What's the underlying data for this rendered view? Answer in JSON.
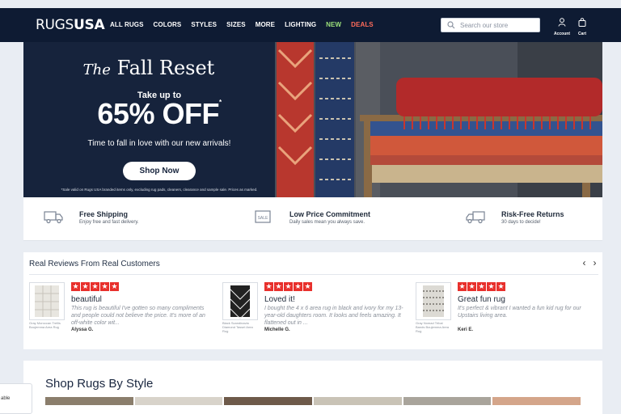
{
  "header": {
    "logo_part1": "RUGS",
    "logo_part2": "USA",
    "nav": [
      "ALL RUGS",
      "COLORS",
      "STYLES",
      "SIZES",
      "MORE",
      "LIGHTING",
      "NEW",
      "DEALS"
    ],
    "search_placeholder": "Search our store",
    "account_label": "Account",
    "cart_label": "Cart",
    "accent_new": "#9be07a",
    "accent_deals": "#ff6b5a"
  },
  "hero": {
    "title_prefix": "The",
    "title_main": "Fall Reset",
    "sub": "Take up to",
    "big": "65% OFF",
    "big_mark": "*",
    "line": "Time to fall in love with our new arrivals!",
    "button": "Shop Now",
    "fine_print": "*Sale valid on Rugs USA branded items only, excluding rug pads, cleaners, clearance and sample sale. Prices as marked."
  },
  "features": [
    {
      "icon": "truck-icon",
      "title": "Free Shipping",
      "sub": "Enjoy free and fast delivery."
    },
    {
      "icon": "price-tag-icon",
      "title": "Low Price Commitment",
      "sub": "Daily sales mean you always save."
    },
    {
      "icon": "return-truck-icon",
      "title": "Risk-Free Returns",
      "sub": "30 days to decide!"
    }
  ],
  "reviews": {
    "heading": "Real Reviews From Real Customers",
    "items": [
      {
        "title": "beautiful",
        "body": "This rug is beautiful I've gotten so many compliments and people could not believe the price. It's more of an off-white color wit...",
        "author": "Alyssa G.",
        "caption": "Gray Moroccan Trellis Boujemma Area Rug"
      },
      {
        "title": "Loved it!",
        "body": "I bought the 4 x 6 area rug in black and ivory for my 13-year-old daughters room. It looks and feels amazing. It flattened out in ...",
        "author": "Michelle G.",
        "caption": "Black Scandinavia Diamond Tassel Area Rug"
      },
      {
        "title": "Great fun rug",
        "body": "It's perfect & vibrant I wanted a fun kid rug for our Upstairs living area.",
        "author": "Keri E.",
        "caption": "Gray Nomad Tribal Bands Boujemma Area Rug"
      }
    ]
  },
  "shop_style": {
    "heading": "Shop Rugs By Style"
  },
  "chat": {
    "label": "able"
  },
  "colors": {
    "navy": "#0e1b33",
    "star_red": "#e8302c"
  }
}
